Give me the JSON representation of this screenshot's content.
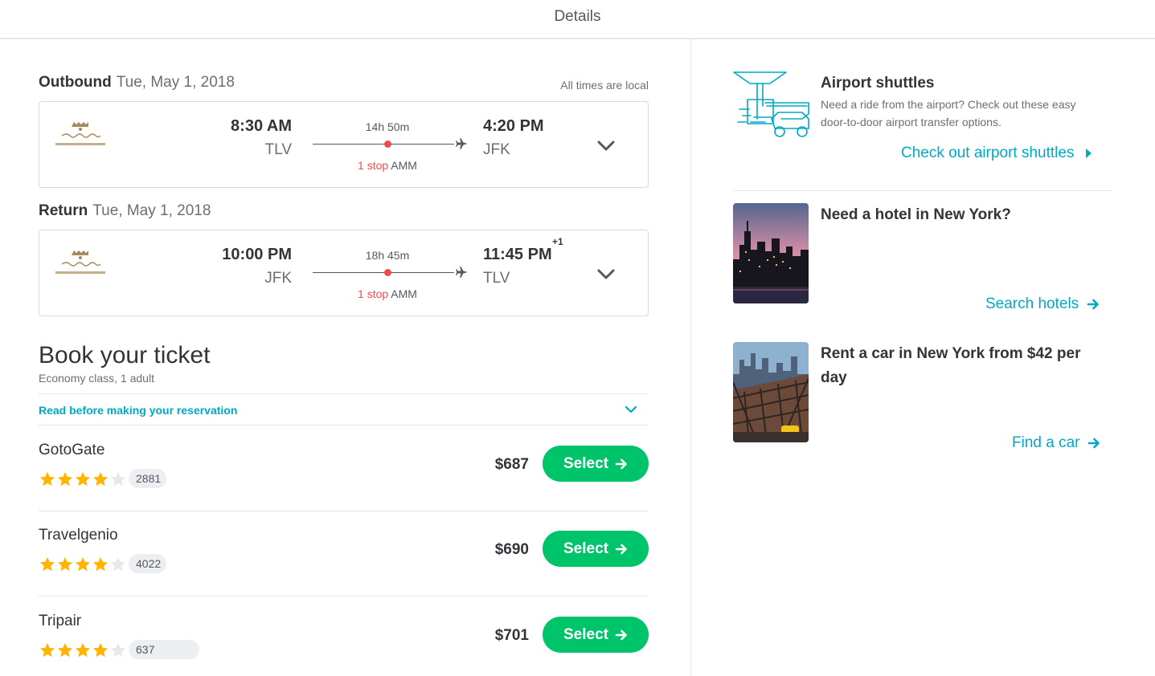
{
  "header": {
    "title": "Details"
  },
  "outbound": {
    "label": "Outbound",
    "date": "Tue, May 1, 2018",
    "times_note": "All times are local",
    "dep_time": "8:30 AM",
    "dep_code": "TLV",
    "arr_time": "4:20 PM",
    "arr_code": "JFK",
    "duration": "14h 50m",
    "stop_count": "1 stop",
    "stop_airport": "AMM"
  },
  "return": {
    "label": "Return",
    "date": "Tue, May 1, 2018",
    "dep_time": "10:00 PM",
    "dep_code": "JFK",
    "arr_time": "11:45 PM",
    "arr_code": "TLV",
    "plus_day": "+1",
    "duration": "18h 45m",
    "stop_count": "1 stop",
    "stop_airport": "AMM"
  },
  "booking": {
    "title": "Book your ticket",
    "subtitle": "Economy class, 1 adult",
    "read_before": "Read before making your reservation",
    "select_label": "Select",
    "agents": [
      {
        "name": "GotoGate",
        "reviews": "2881",
        "price": "$687",
        "rating": 4
      },
      {
        "name": "Travelgenio",
        "reviews": "4022",
        "price": "$690",
        "rating": 4
      },
      {
        "name": "Tripair",
        "reviews": "637",
        "price": "$701",
        "rating": 4
      }
    ]
  },
  "sidebar": {
    "shuttles": {
      "title": "Airport shuttles",
      "desc_line1": "Need a ride from the airport? Check out these easy",
      "desc_line2": "door-to-door airport transfer options.",
      "link": "Check out airport shuttles"
    },
    "hotel": {
      "title": "Need a hotel in New York?",
      "link": "Search hotels"
    },
    "car": {
      "title_line1": "Rent a car in New York from $42 per",
      "title_line2": "day",
      "link": "Find a car"
    }
  },
  "colors": {
    "accent": "#00a9c3",
    "select_button": "#00c46a",
    "stop_red": "#f04b4b",
    "star": "#ffb400"
  }
}
